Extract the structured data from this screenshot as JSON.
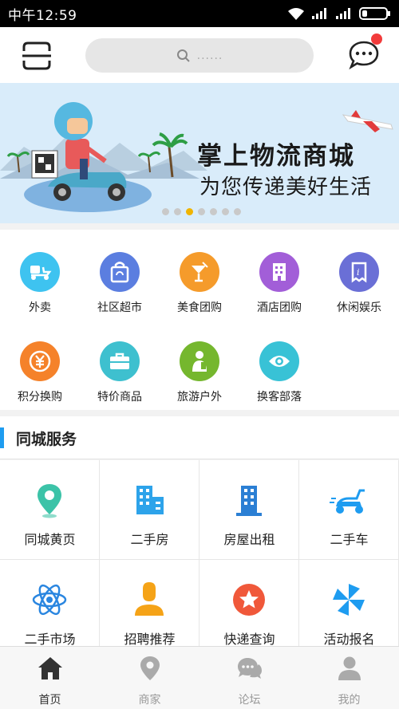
{
  "status_bar": {
    "time": "中午12:59"
  },
  "header": {
    "search_placeholder": "......",
    "has_unread": true
  },
  "banner": {
    "title": "掌上物流商城",
    "subtitle": "为您传递美好生活",
    "dots_total": 7,
    "dots_active": 3
  },
  "categories": [
    {
      "label": "外卖",
      "icon": "scooter-icon",
      "color": "#3ec3f0"
    },
    {
      "label": "社区超市",
      "icon": "shopping-bag-icon",
      "color": "#5b7ee0"
    },
    {
      "label": "美食团购",
      "icon": "cocktail-icon",
      "color": "#f59b2b"
    },
    {
      "label": "酒店团购",
      "icon": "hotel-building-icon",
      "color": "#a25ed8"
    },
    {
      "label": "休闲娱乐",
      "icon": "ticket-icon",
      "color": "#6a6fd6"
    },
    {
      "label": "积分换购",
      "icon": "yen-coin-icon",
      "color": "#f5822a"
    },
    {
      "label": "特价商品",
      "icon": "briefcase-icon",
      "color": "#3ec0cf"
    },
    {
      "label": "旅游户外",
      "icon": "tourist-icon",
      "color": "#75b72e"
    },
    {
      "label": "换客部落",
      "icon": "eye-icon",
      "color": "#38c2d6"
    }
  ],
  "services": {
    "title": "同城服务",
    "items": [
      {
        "label": "同城黄页",
        "icon": "map-pin-icon"
      },
      {
        "label": "二手房",
        "icon": "buildings-icon"
      },
      {
        "label": "房屋出租",
        "icon": "apartment-icon"
      },
      {
        "label": "二手车",
        "icon": "scooter-icon"
      },
      {
        "label": "二手市场",
        "icon": "atom-icon"
      },
      {
        "label": "招聘推荐",
        "icon": "person-icon"
      },
      {
        "label": "快递查询",
        "icon": "star-badge-icon"
      },
      {
        "label": "活动报名",
        "icon": "pinwheel-icon"
      }
    ]
  },
  "tabs": [
    {
      "label": "首页",
      "icon": "home-icon",
      "active": true
    },
    {
      "label": "商家",
      "icon": "location-icon",
      "active": false
    },
    {
      "label": "论坛",
      "icon": "chat-icon",
      "active": false
    },
    {
      "label": "我的",
      "icon": "user-icon",
      "active": false
    }
  ],
  "colors": {
    "accent": "#1e9cf0",
    "badge": "#f23b3b",
    "dot_active": "#f0b400"
  }
}
